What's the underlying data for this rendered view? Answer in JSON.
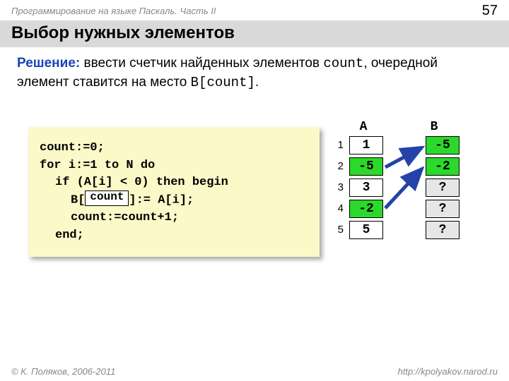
{
  "header": {
    "course": "Программирование на языке Паскаль. Часть II",
    "page": "57"
  },
  "title": "Выбор нужных элементов",
  "solution_label": "Решение:",
  "solution_text1": " ввести счетчик найденных элементов ",
  "solution_code1": "count",
  "solution_text2": ", очередной элемент ставится на место ",
  "solution_code2": "B[count]",
  "solution_text3": ".",
  "code": {
    "l1": "count:=0;",
    "l2": "for i:=1 to N do",
    "l3": "if (A[i] < 0) then begin",
    "l4a": "B[",
    "l4b": "]:= A[i];",
    "blank": "count",
    "l5": "count:=count+1;",
    "l6": "end;"
  },
  "arrays": {
    "labelA": "A",
    "labelB": "B",
    "idx": [
      "1",
      "2",
      "3",
      "4",
      "5"
    ],
    "A": [
      {
        "v": "1",
        "c": "white"
      },
      {
        "v": "-5",
        "c": "green"
      },
      {
        "v": "3",
        "c": "white"
      },
      {
        "v": "-2",
        "c": "green"
      },
      {
        "v": "5",
        "c": "white"
      }
    ],
    "B": [
      {
        "v": "-5",
        "c": "green"
      },
      {
        "v": "-2",
        "c": "green"
      },
      {
        "v": "?",
        "c": "gray"
      },
      {
        "v": "?",
        "c": "gray"
      },
      {
        "v": "?",
        "c": "gray"
      }
    ]
  },
  "footer": {
    "left": "© К. Поляков, 2006-2011",
    "right": "http://kpolyakov.narod.ru"
  }
}
